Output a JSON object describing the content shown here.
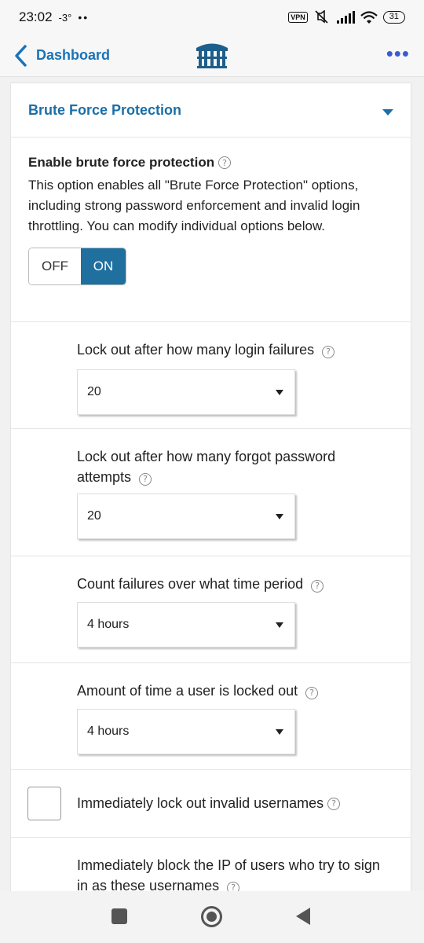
{
  "status": {
    "time": "23:02",
    "temp": "-3°",
    "dots": "••",
    "vpn": "VPN",
    "battery": "31"
  },
  "app_bar": {
    "back_label": "Dashboard",
    "more": "•••"
  },
  "panel": {
    "title": "Brute Force Protection",
    "enable": {
      "title": "Enable brute force protection",
      "description": "This option enables all \"Brute Force Protection\" options, including strong password enforcement and invalid login throttling. You can modify individual options below.",
      "off_label": "OFF",
      "on_label": "ON",
      "state": "ON"
    },
    "fields": [
      {
        "label": "Lock out after how many login failures",
        "value": "20"
      },
      {
        "label": "Lock out after how many forgot password attempts",
        "value": "20"
      },
      {
        "label": "Count failures over what time period",
        "value": "4 hours"
      },
      {
        "label": "Amount of time a user is locked out",
        "value": "4 hours"
      }
    ],
    "checkbox": {
      "label": "Immediately lock out invalid usernames",
      "checked": false
    },
    "block": {
      "label": "Immediately block the IP of users who try to sign in as these usernames"
    },
    "help_glyph": "?"
  },
  "colors": {
    "accent": "#1a6fa6",
    "toggle_on": "#1f6f9f",
    "nav_blue": "#3b5bd6"
  }
}
